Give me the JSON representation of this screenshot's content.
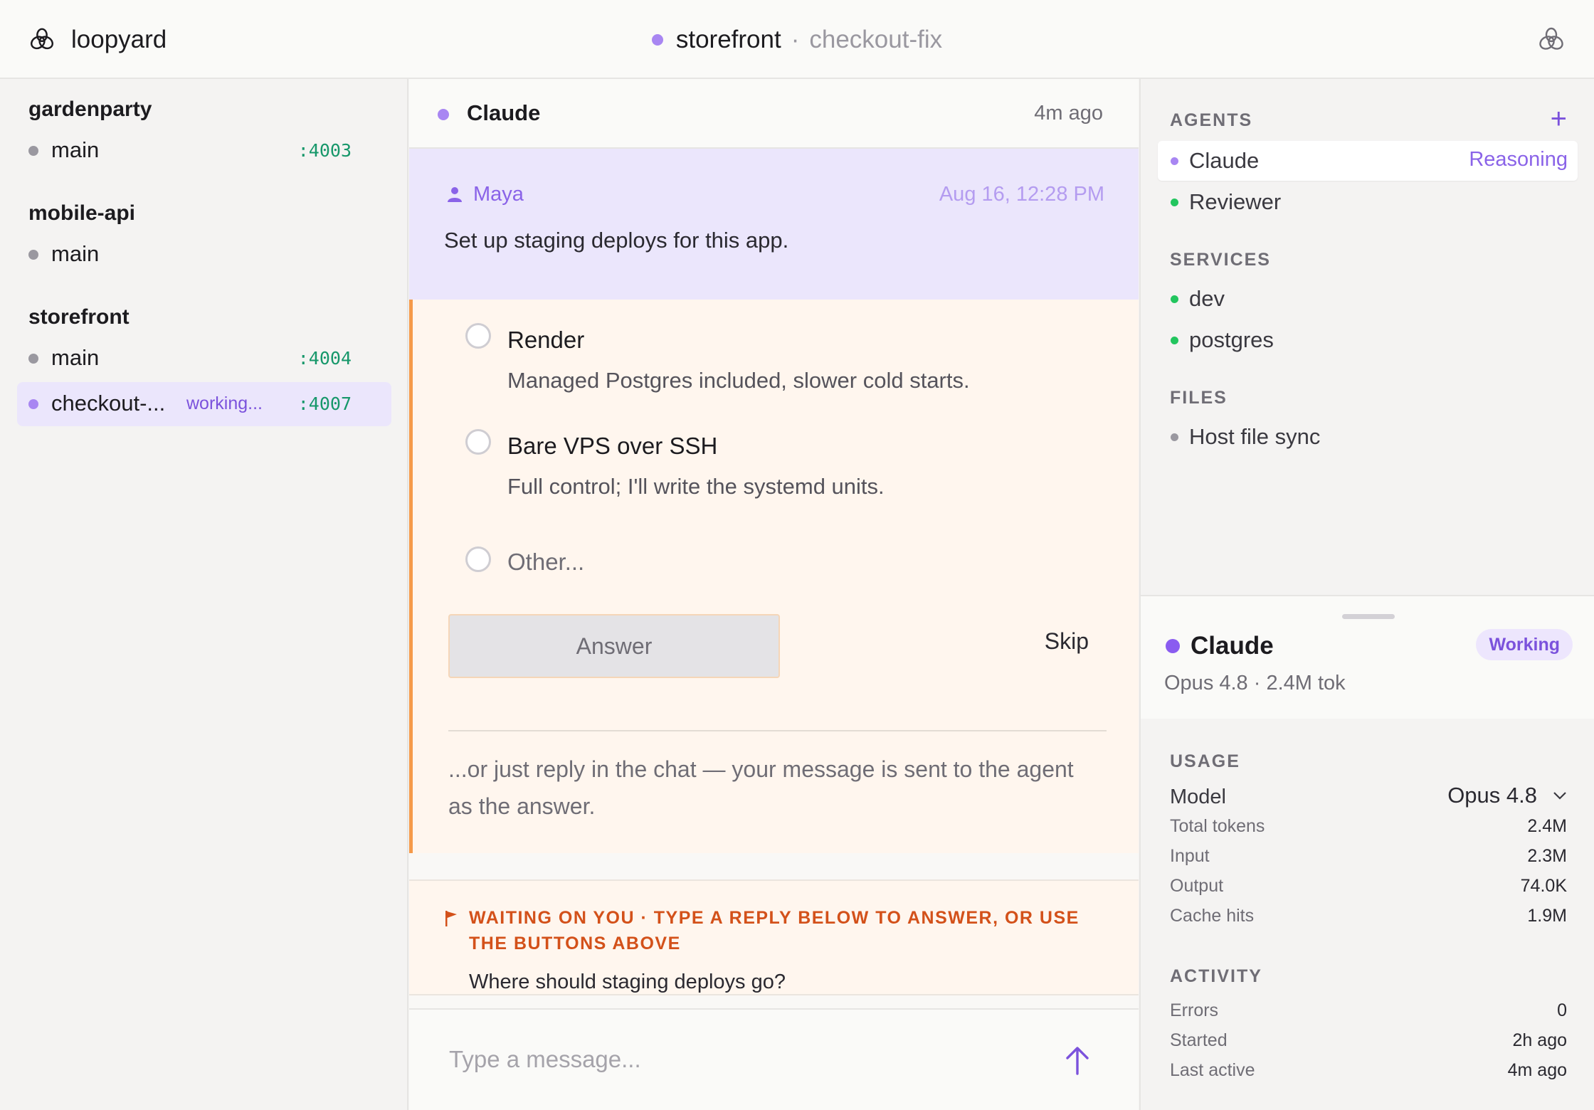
{
  "app": {
    "name": "loopyard",
    "project": "storefront",
    "separator": "·",
    "branch": "checkout-fix"
  },
  "sidebar": {
    "groups": [
      {
        "title": "gardenparty",
        "branches": [
          {
            "label": "main",
            "status": "",
            "port": ":4003"
          }
        ]
      },
      {
        "title": "mobile-api",
        "branches": [
          {
            "label": "main",
            "status": "",
            "port": ""
          }
        ]
      },
      {
        "title": "storefront",
        "branches": [
          {
            "label": "main",
            "status": "",
            "port": ":4004"
          },
          {
            "label": "checkout-...",
            "status": "working...",
            "port": ":4007"
          }
        ]
      }
    ]
  },
  "chat": {
    "agent": "Claude",
    "time": "4m ago",
    "user_message": {
      "author": "Maya",
      "time": "Aug 16, 12:28 PM",
      "text": "Set up staging deploys for this app."
    },
    "question": {
      "options": [
        {
          "title": "Render",
          "description": "Managed Postgres included, slower cold starts."
        },
        {
          "title": "Bare VPS over SSH",
          "description": "Full control; I'll write the systemd units."
        }
      ],
      "other_label": "Other...",
      "answer_label": "Answer",
      "skip_label": "Skip",
      "hint": "...or just reply in the chat — your message is sent to the agent as the answer."
    },
    "waiting": {
      "title": "WAITING ON YOU · TYPE A REPLY BELOW TO ANSWER, OR USE THE BUTTONS ABOVE",
      "question": "Where should staging deploys go?"
    },
    "composer": {
      "placeholder": "Type a message..."
    }
  },
  "right_panel": {
    "agents_label": "AGENTS",
    "add_label": "+",
    "agents": [
      {
        "name": "Claude",
        "status": "Reasoning",
        "color": "#a886f2"
      },
      {
        "name": "Reviewer",
        "status": "",
        "color": "#22c55e"
      }
    ],
    "services_label": "SERVICES",
    "services": [
      {
        "name": "dev",
        "color": "#22c55e"
      },
      {
        "name": "postgres",
        "color": "#22c55e"
      }
    ],
    "files_label": "FILES",
    "files": [
      {
        "name": "Host file sync",
        "color": "#9a98a0"
      }
    ],
    "detail": {
      "name": "Claude",
      "badge": "Working",
      "subtitle": "Opus 4.8 · 2.4M tok",
      "usage_label": "USAGE",
      "model_label": "Model",
      "model_value": "Opus 4.8",
      "usage": [
        {
          "label": "Total tokens",
          "value": "2.4M"
        },
        {
          "label": "Input",
          "value": "2.3M"
        },
        {
          "label": "Output",
          "value": "74.0K"
        },
        {
          "label": "Cache hits",
          "value": "1.9M"
        }
      ],
      "activity_label": "ACTIVITY",
      "activity": [
        {
          "label": "Errors",
          "value": "0"
        },
        {
          "label": "Started",
          "value": "2h ago"
        },
        {
          "label": "Last active",
          "value": "4m ago"
        }
      ]
    }
  },
  "colors": {
    "accent": "#7b52dc",
    "accent_light": "#a886f2",
    "warning": "#d3511a",
    "success": "#22c55e",
    "port": "#16976a"
  },
  "icons": {
    "brand": "loop-logo-icon",
    "top_right": "loop-logo-icon",
    "user": "person-icon",
    "flag": "flag-icon",
    "send": "arrow-up-icon",
    "model_dropdown": "chevron-down-icon"
  }
}
